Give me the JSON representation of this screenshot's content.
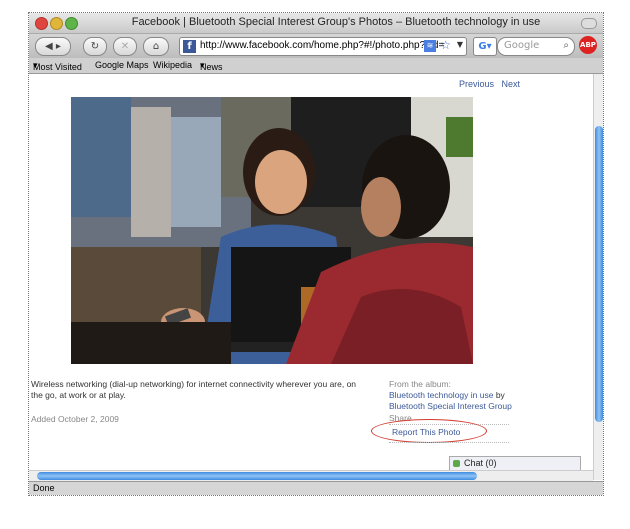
{
  "window": {
    "title": "Facebook | Bluetooth Special Interest Group's Photos – Bluetooth technology in use"
  },
  "toolbar": {
    "back_icon": "back-arrow-icon",
    "forward_icon": "forward-arrow-icon",
    "reload_icon": "reload-icon",
    "stop_icon": "stop-icon",
    "home_icon": "home-icon",
    "url": "http://www.facebook.com/home.php?#!/photo.php?pid=",
    "search_placeholder": "Google",
    "addon_label": "ABP"
  },
  "bookmarks": {
    "items": [
      "Most Visited",
      "Google Maps",
      "Wikipedia",
      "News"
    ]
  },
  "photo_page": {
    "previous_label": "Previous",
    "next_label": "Next",
    "description": "Wireless networking (dial-up networking) for internet connectivity wherever you are, on the go, at work or at play.",
    "added": "Added October 2, 2009",
    "album_label": "From the album:",
    "album_name": "Bluetooth technology in use",
    "by_label": "by",
    "owner_name": "Bluetooth Special Interest Group",
    "share_label": "Share",
    "report_label": "Report This Photo"
  },
  "chat": {
    "label": "Chat (0)"
  },
  "status": {
    "text": "Done"
  },
  "colors": {
    "link": "#3b5998",
    "highlight_oval": "#d23b2e",
    "scroll_thumb": "#3d8be0"
  }
}
